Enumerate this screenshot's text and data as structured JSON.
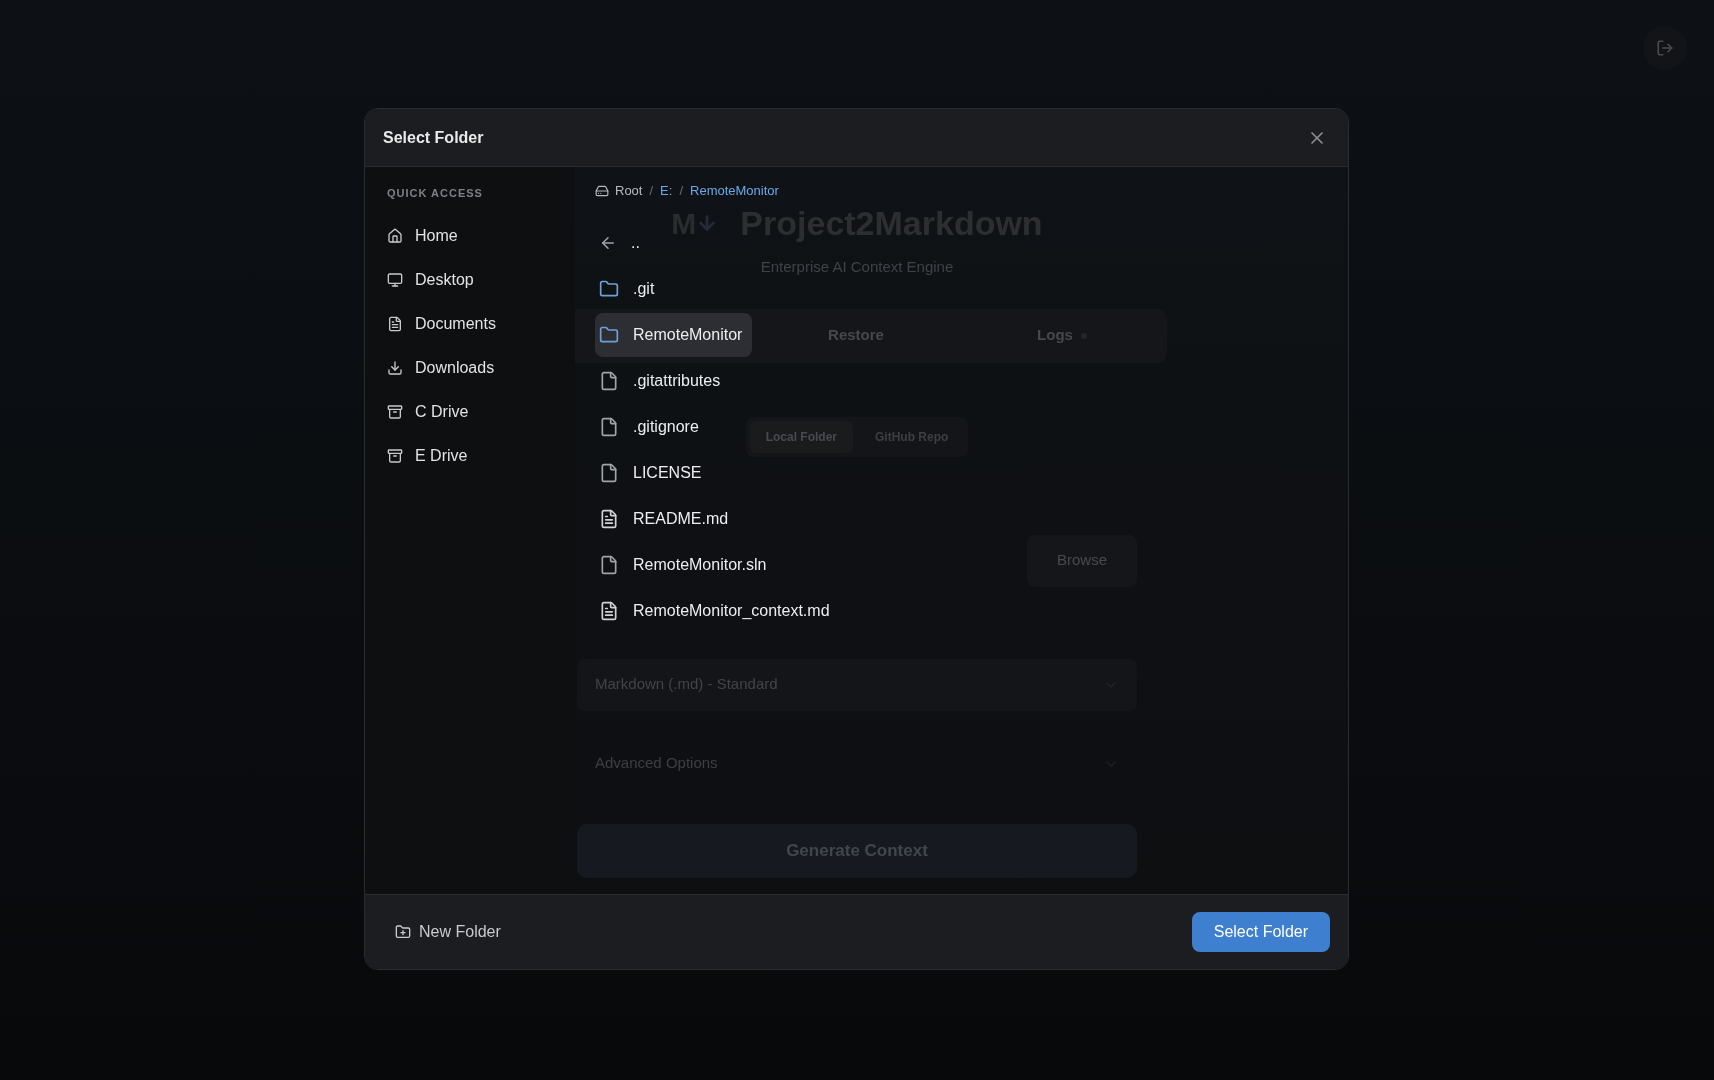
{
  "background_app": {
    "logo_text": "M",
    "title": "Project2Markdown",
    "subtitle": "Enterprise AI Context Engine",
    "tabs": [
      {
        "label": "Restore",
        "dot": false
      },
      {
        "label": "Logs",
        "dot": true
      }
    ],
    "source_toggle": [
      {
        "label": "Local Folder",
        "selected": true
      },
      {
        "label": "GitHub Repo",
        "selected": false
      }
    ],
    "browse_button": "Browse",
    "format_select": "Markdown (.md) - Standard",
    "advanced_options": "Advanced Options",
    "generate_button": "Generate Context"
  },
  "dialog": {
    "title": "Select Folder",
    "sidebar": {
      "heading": "QUICK ACCESS",
      "items": [
        {
          "label": "Home",
          "kind": "home"
        },
        {
          "label": "Desktop",
          "kind": "desktop"
        },
        {
          "label": "Documents",
          "kind": "documents"
        },
        {
          "label": "Downloads",
          "kind": "downloads"
        },
        {
          "label": "C Drive",
          "kind": "drive"
        },
        {
          "label": "E Drive",
          "kind": "drive"
        }
      ]
    },
    "breadcrumb": [
      {
        "label": "Root",
        "kind": "root"
      },
      {
        "label": "E:",
        "kind": "path"
      },
      {
        "label": "RemoteMonitor",
        "kind": "path"
      }
    ],
    "breadcrumb_separator": "/",
    "entries": [
      {
        "name": "..",
        "kind": "parent",
        "highlighted": false
      },
      {
        "name": ".git",
        "kind": "folder",
        "highlighted": false
      },
      {
        "name": "RemoteMonitor",
        "kind": "folder",
        "highlighted": true
      },
      {
        "name": ".gitattributes",
        "kind": "file",
        "highlighted": false
      },
      {
        "name": ".gitignore",
        "kind": "file",
        "highlighted": false
      },
      {
        "name": "LICENSE",
        "kind": "file",
        "highlighted": false
      },
      {
        "name": "README.md",
        "kind": "text",
        "highlighted": false
      },
      {
        "name": "RemoteMonitor.sln",
        "kind": "file",
        "highlighted": false
      },
      {
        "name": "RemoteMonitor_context.md",
        "kind": "text",
        "highlighted": false
      }
    ],
    "new_folder_button": "New Folder",
    "select_button": "Select Folder"
  }
}
